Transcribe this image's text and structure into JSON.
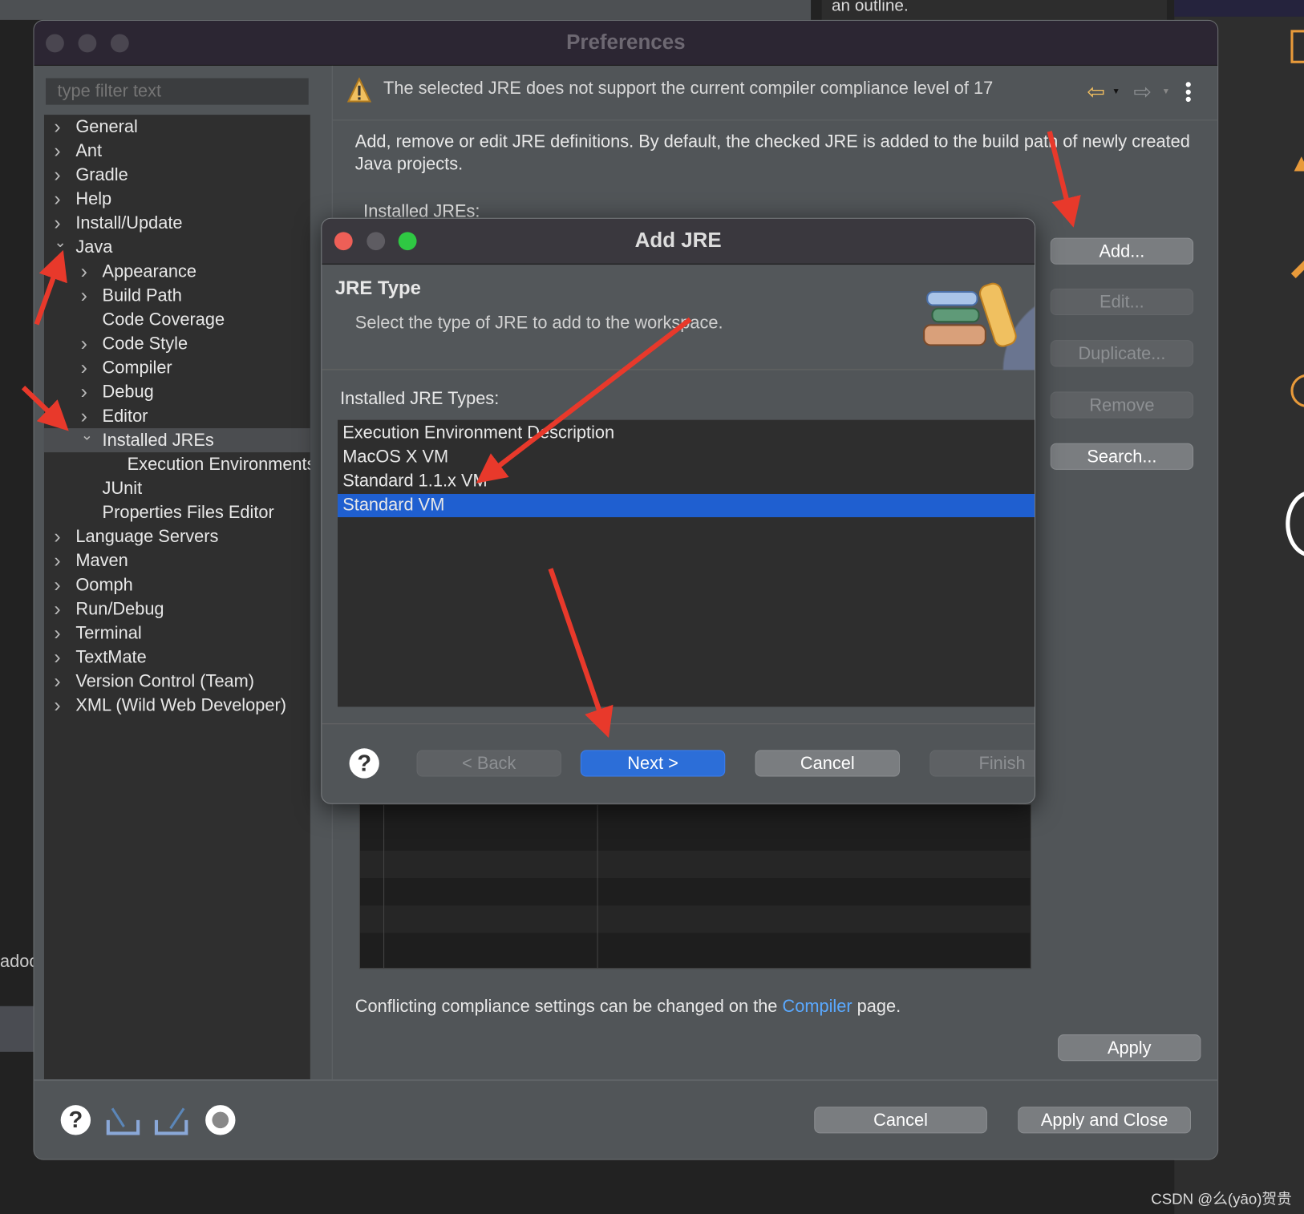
{
  "background": {
    "outline_text": "an outline.",
    "side_text": "adoc",
    "watermark": "CSDN @么(yāo)贺贵"
  },
  "preferences": {
    "title": "Preferences",
    "filter_placeholder": "type filter text",
    "tree": [
      {
        "label": "General",
        "level": 0,
        "expanded": false
      },
      {
        "label": "Ant",
        "level": 0,
        "expanded": false
      },
      {
        "label": "Gradle",
        "level": 0,
        "expanded": false
      },
      {
        "label": "Help",
        "level": 0,
        "expanded": false
      },
      {
        "label": "Install/Update",
        "level": 0,
        "expanded": false
      },
      {
        "label": "Java",
        "level": 0,
        "expanded": true
      },
      {
        "label": "Appearance",
        "level": 1,
        "expanded": false
      },
      {
        "label": "Build Path",
        "level": 1,
        "expanded": false
      },
      {
        "label": "Code Coverage",
        "level": 1,
        "leaf": true
      },
      {
        "label": "Code Style",
        "level": 1,
        "expanded": false
      },
      {
        "label": "Compiler",
        "level": 1,
        "expanded": false
      },
      {
        "label": "Debug",
        "level": 1,
        "expanded": false
      },
      {
        "label": "Editor",
        "level": 1,
        "expanded": false
      },
      {
        "label": "Installed JREs",
        "level": 1,
        "expanded": true,
        "selected": true
      },
      {
        "label": "Execution Environments",
        "level": 2,
        "leaf": true
      },
      {
        "label": "JUnit",
        "level": 1,
        "leaf": true
      },
      {
        "label": "Properties Files Editor",
        "level": 1,
        "leaf": true
      },
      {
        "label": "Language Servers",
        "level": 0,
        "expanded": false
      },
      {
        "label": "Maven",
        "level": 0,
        "expanded": false
      },
      {
        "label": "Oomph",
        "level": 0,
        "expanded": false
      },
      {
        "label": "Run/Debug",
        "level": 0,
        "expanded": false
      },
      {
        "label": "Terminal",
        "level": 0,
        "expanded": false
      },
      {
        "label": "TextMate",
        "level": 0,
        "expanded": false
      },
      {
        "label": "Version Control (Team)",
        "level": 0,
        "expanded": false
      },
      {
        "label": "XML (Wild Web Developer)",
        "level": 0,
        "expanded": false
      }
    ],
    "warning": "The selected JRE does not support the current compiler compliance level of 17",
    "description": "Add, remove or edit JRE definitions. By default, the checked JRE is added to the build path of newly created Java projects.",
    "installed_label": "Installed JREs:",
    "buttons": {
      "add": "Add...",
      "edit": "Edit...",
      "duplicate": "Duplicate...",
      "remove": "Remove",
      "search": "Search..."
    },
    "compliance_pre": "Conflicting compliance settings can be changed on the ",
    "compliance_link": "Compiler",
    "compliance_post": " page.",
    "apply": "Apply",
    "cancel": "Cancel",
    "apply_close": "Apply and Close"
  },
  "add_jre": {
    "title": "Add JRE",
    "heading": "JRE Type",
    "subtitle": "Select the type of JRE to add to the workspace.",
    "list_label": "Installed JRE Types:",
    "types": [
      "Execution Environment Description",
      "MacOS X VM",
      "Standard 1.1.x VM",
      "Standard VM"
    ],
    "selected": "Standard VM",
    "back": "< Back",
    "next": "Next >",
    "cancel": "Cancel",
    "finish": "Finish"
  },
  "colors": {
    "accent": "#1f5fd0",
    "annotation": "#e8392b",
    "warning": "#f0c060"
  }
}
